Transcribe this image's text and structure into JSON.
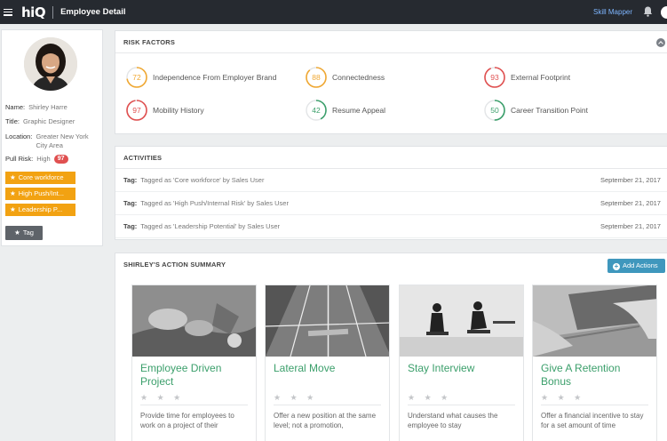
{
  "topbar": {
    "logo": "hiQ",
    "title": "Employee Detail",
    "skill_mapper": "Skill Mapper"
  },
  "employee": {
    "name_label": "Name:",
    "name": "Shirley Harre",
    "title_label": "Title:",
    "title": "Graphic Designer",
    "location_label": "Location:",
    "location": "Greater New York City Area",
    "pull_risk_label": "Pull Risk:",
    "pull_risk": "High",
    "pull_risk_score": "97",
    "tags": [
      "Core workforce",
      "High Push/Int...",
      "Leadership P..."
    ],
    "add_tag_label": "Tag"
  },
  "risk_factors": {
    "heading": "RISK FACTORS",
    "items": [
      {
        "label": "Independence From Employer Brand",
        "value": 72,
        "color": "#f0a832"
      },
      {
        "label": "Connectedness",
        "value": 88,
        "color": "#f0a832"
      },
      {
        "label": "External Footprint",
        "value": 93,
        "color": "#e05050"
      },
      {
        "label": "Mobility History",
        "value": 97,
        "color": "#e05050"
      },
      {
        "label": "Resume Appeal",
        "value": 42,
        "color": "#3b9f6b"
      },
      {
        "label": "Career Transition Point",
        "value": 50,
        "color": "#3b9f6b"
      }
    ]
  },
  "activities": {
    "heading": "ACTIVITIES",
    "rows": [
      {
        "type": "Tag:",
        "text": "Tagged as 'Core workforce' by Sales User",
        "date": "September 21, 2017"
      },
      {
        "type": "Tag:",
        "text": "Tagged as 'High Push/Internal Risk' by Sales User",
        "date": "September 21, 2017"
      },
      {
        "type": "Tag:",
        "text": "Tagged as 'Leadership Potential' by Sales User",
        "date": "September 21, 2017"
      }
    ]
  },
  "action_summary": {
    "heading": "SHIRLEY'S ACTION SUMMARY",
    "add_actions_label": "Add Actions",
    "cards": [
      {
        "title": "Employee Driven Project",
        "stars": "★ ★ ★",
        "desc": "Provide time for employees to work on a project of their"
      },
      {
        "title": "Lateral Move",
        "stars": "★ ★ ★",
        "desc": "Offer a new position at the same level; not a promotion,"
      },
      {
        "title": "Stay Interview",
        "stars": "★ ★ ★",
        "desc": "Understand what causes the employee to stay"
      },
      {
        "title": "Give A Retention Bonus",
        "stars": "★ ★ ★",
        "desc": "Offer a financial incentive to stay for a set amount of time"
      }
    ]
  },
  "colors": {
    "accent_green": "#3b9f6b",
    "accent_orange": "#f2a212",
    "accent_red": "#e05050",
    "accent_blue": "#3f97bd",
    "topbar": "#262a30"
  }
}
